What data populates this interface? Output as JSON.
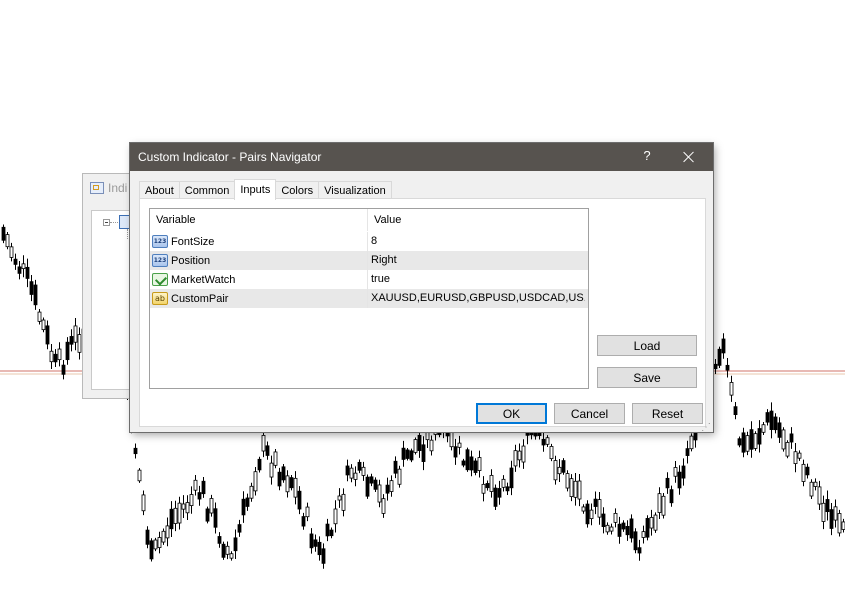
{
  "background_window": {
    "title": "Indi"
  },
  "dialog": {
    "title": "Custom Indicator - Pairs Navigator",
    "help_label": "?",
    "tabs": [
      {
        "label": "About",
        "active": false
      },
      {
        "label": "Common",
        "active": false
      },
      {
        "label": "Inputs",
        "active": true
      },
      {
        "label": "Colors",
        "active": false
      },
      {
        "label": "Visualization",
        "active": false
      }
    ],
    "inputs_table": {
      "headers": {
        "variable": "Variable",
        "value": "Value"
      },
      "rows": [
        {
          "variable": "FontSize",
          "value": "8",
          "type_icon": "int-icon",
          "type_label": "123"
        },
        {
          "variable": "Position",
          "value": "Right",
          "type_icon": "int-icon",
          "type_label": "123"
        },
        {
          "variable": "MarketWatch",
          "value": "true",
          "type_icon": "bool-icon",
          "type_label": ""
        },
        {
          "variable": "CustomPair",
          "value": "XAUUSD,EURUSD,GBPUSD,USDCAD,US...",
          "type_icon": "string-icon",
          "type_label": "ab"
        }
      ]
    },
    "buttons": {
      "load": "Load",
      "save": "Save",
      "ok": "OK",
      "cancel": "Cancel",
      "reset": "Reset"
    }
  },
  "colors": {
    "titlebar": "#57534f",
    "candle": "#000000",
    "price_line": "#c0392b",
    "focus": "#0078d7"
  }
}
